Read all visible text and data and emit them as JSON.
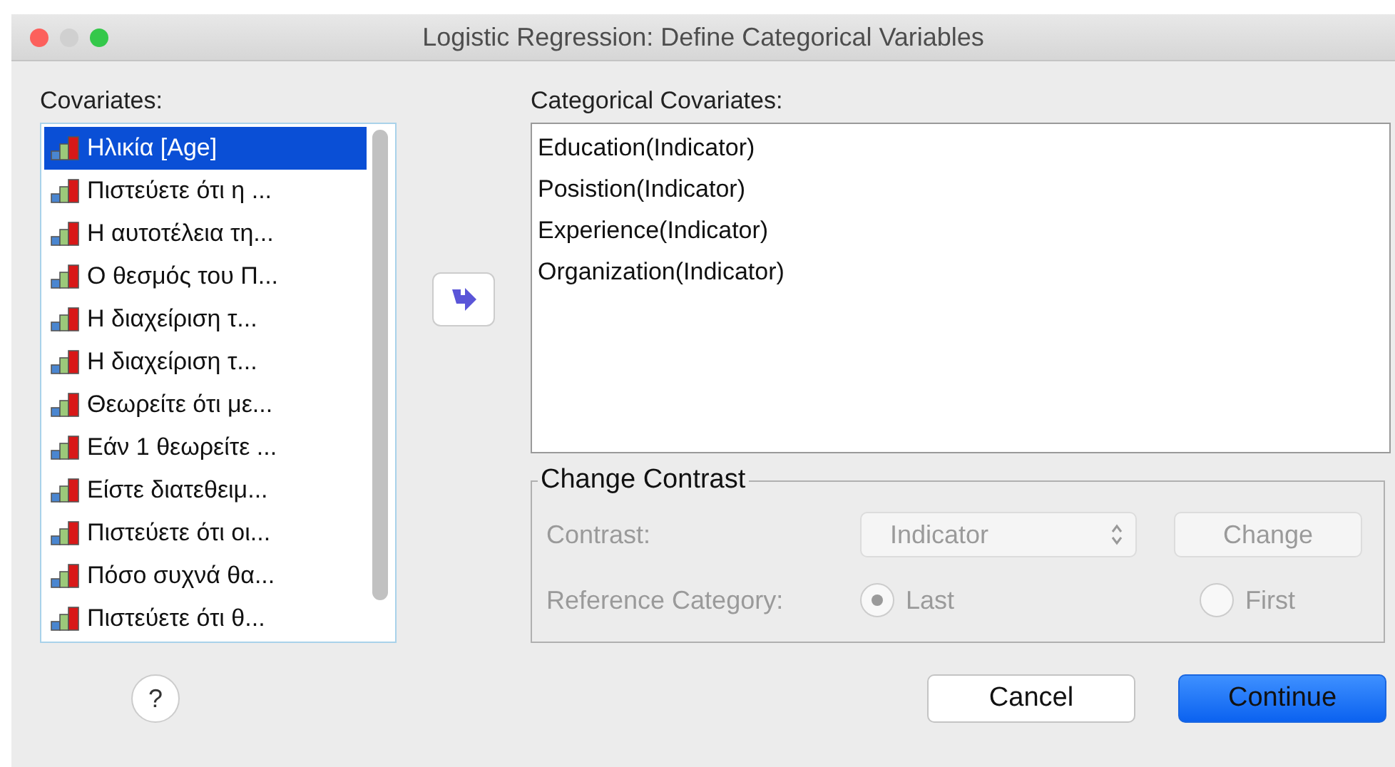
{
  "window": {
    "title": "Logistic Regression: Define Categorical Variables"
  },
  "covariates": {
    "label": "Covariates:",
    "items": [
      {
        "text": "Ηλικία [Age]",
        "selected": true
      },
      {
        "text": "Πιστεύετε ότι η ...",
        "selected": false
      },
      {
        "text": "Η αυτοτέλεια τη...",
        "selected": false
      },
      {
        "text": "Ο θεσμός του Π...",
        "selected": false
      },
      {
        "text": "Η διαχείριση τ...",
        "selected": false
      },
      {
        "text": "Η διαχείριση τ...",
        "selected": false
      },
      {
        "text": "Θεωρείτε ότι με...",
        "selected": false
      },
      {
        "text": "Εάν 1 θεωρείτε ...",
        "selected": false
      },
      {
        "text": "Είστε διατεθειμ...",
        "selected": false
      },
      {
        "text": "Πιστεύετε ότι οι...",
        "selected": false
      },
      {
        "text": "Πόσο συχνά  θα...",
        "selected": false
      },
      {
        "text": "Πιστεύετε ότι θ...",
        "selected": false
      }
    ]
  },
  "categorical": {
    "label": "Categorical Covariates:",
    "items": [
      {
        "text": "Education(Indicator)",
        "selected": false
      },
      {
        "text": "Posistion(Indicator)",
        "selected": false
      },
      {
        "text": "Experience(Indicator)",
        "selected": false
      },
      {
        "text": "Organization(Indicator)",
        "selected": false
      }
    ]
  },
  "change_contrast": {
    "title": "Change Contrast",
    "disabled": true,
    "contrast_label": "Contrast:",
    "contrast_value": "Indicator",
    "change_button": "Change",
    "reference_label": "Reference Category:",
    "options": [
      {
        "label": "Last",
        "selected": true
      },
      {
        "label": "First",
        "selected": false
      }
    ]
  },
  "help": "?",
  "buttons": [
    {
      "label": "Cancel",
      "kind": "normal"
    },
    {
      "label": "Continue",
      "kind": "default"
    }
  ]
}
